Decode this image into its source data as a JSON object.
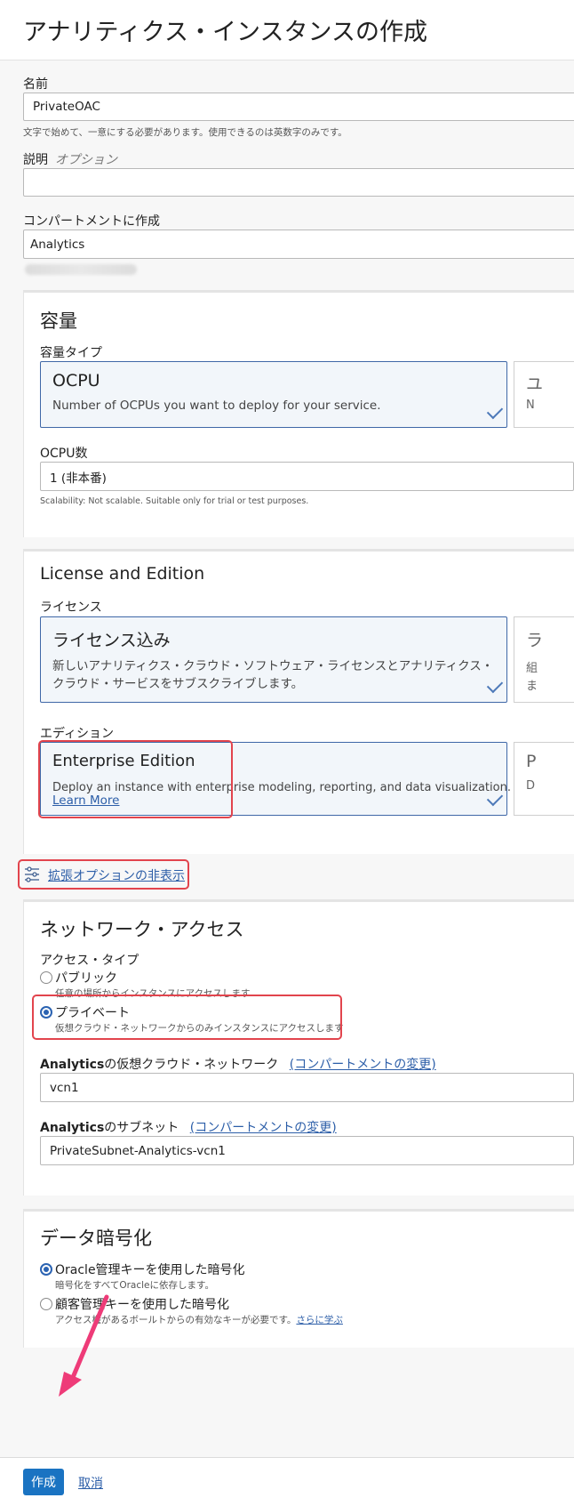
{
  "header": {
    "title": "アナリティクス・インスタンスの作成"
  },
  "form": {
    "name": {
      "label": "名前",
      "value": "PrivateOAC",
      "help": "文字で始めて、一意にする必要があります。使用できるのは英数字のみです。"
    },
    "description": {
      "label": "説明",
      "optional": "オプション",
      "value": ""
    },
    "compartment": {
      "label": "コンパートメントに作成",
      "value": "Analytics"
    }
  },
  "capacity": {
    "title": "容量",
    "type_label": "容量タイプ",
    "ocpu_card": {
      "title": "OCPU",
      "description": "Number of OCPUs you want to deploy for your service."
    },
    "ghost_card": {
      "title_fragment": "ユ",
      "desc_fragment": "N"
    },
    "count_label": "OCPU数",
    "count_value": "1 (非本番)",
    "scalability_help": "Scalability: Not scalable. Suitable only for trial or test purposes."
  },
  "license_edition": {
    "title": "License and Edition",
    "license_label": "ライセンス",
    "license_card": {
      "title": "ライセンス込み",
      "description_line1": "新しいアナリティクス・クラウド・ソフトウェア・ライセンスとアナリティクス・",
      "description_line2": "クラウド・サービスをサブスクライブします。"
    },
    "license_ghost": {
      "title_fragment": "ラ",
      "desc_fragment1": "組",
      "desc_fragment2": "ま"
    },
    "edition_label": "エディション",
    "edition_card": {
      "title": "Enterprise Edition",
      "description": "Deploy an instance with enterprise modeling, reporting, and data visualization.",
      "learn_more": "Learn More"
    },
    "edition_ghost": {
      "title_fragment": "P",
      "desc_fragment": "D"
    }
  },
  "advanced_toggle": {
    "label": "拡張オプションの非表示",
    "icon": "sliders-icon"
  },
  "network": {
    "title": "ネットワーク・アクセス",
    "access_type_label": "アクセス・タイプ",
    "public": {
      "label": "パブリック",
      "help": "任意の場所からインスタンスにアクセスします"
    },
    "private": {
      "label": "プライベート",
      "help": "仮想クラウド・ネットワークからのみインスタンスにアクセスします"
    },
    "selected": "private",
    "vcn": {
      "label_bold": "Analytics",
      "label_rest": "の仮想クラウド・ネットワーク",
      "change_link": "(コンパートメントの変更)",
      "value": "vcn1"
    },
    "subnet": {
      "label_bold": "Analytics",
      "label_rest": "のサブネット",
      "change_link": "(コンパートメントの変更)",
      "value": "PrivateSubnet-Analytics-vcn1"
    }
  },
  "encryption": {
    "title": "データ暗号化",
    "oracle": {
      "label": "Oracle管理キーを使用した暗号化",
      "help": "暗号化をすべてOracleに依存します。"
    },
    "customer": {
      "label": "顧客管理キーを使用した暗号化",
      "help": "アクセス権があるボールトからの有効なキーが必要です。",
      "learn_more": "さらに学ぶ"
    },
    "selected": "oracle"
  },
  "footer": {
    "create_label": "作成",
    "cancel_label": "取消"
  },
  "colors": {
    "accent": "#2b63b2",
    "primary_button": "#1a73c2",
    "annotation_red": "#e2444d",
    "annotation_pink": "#ee3b78"
  }
}
